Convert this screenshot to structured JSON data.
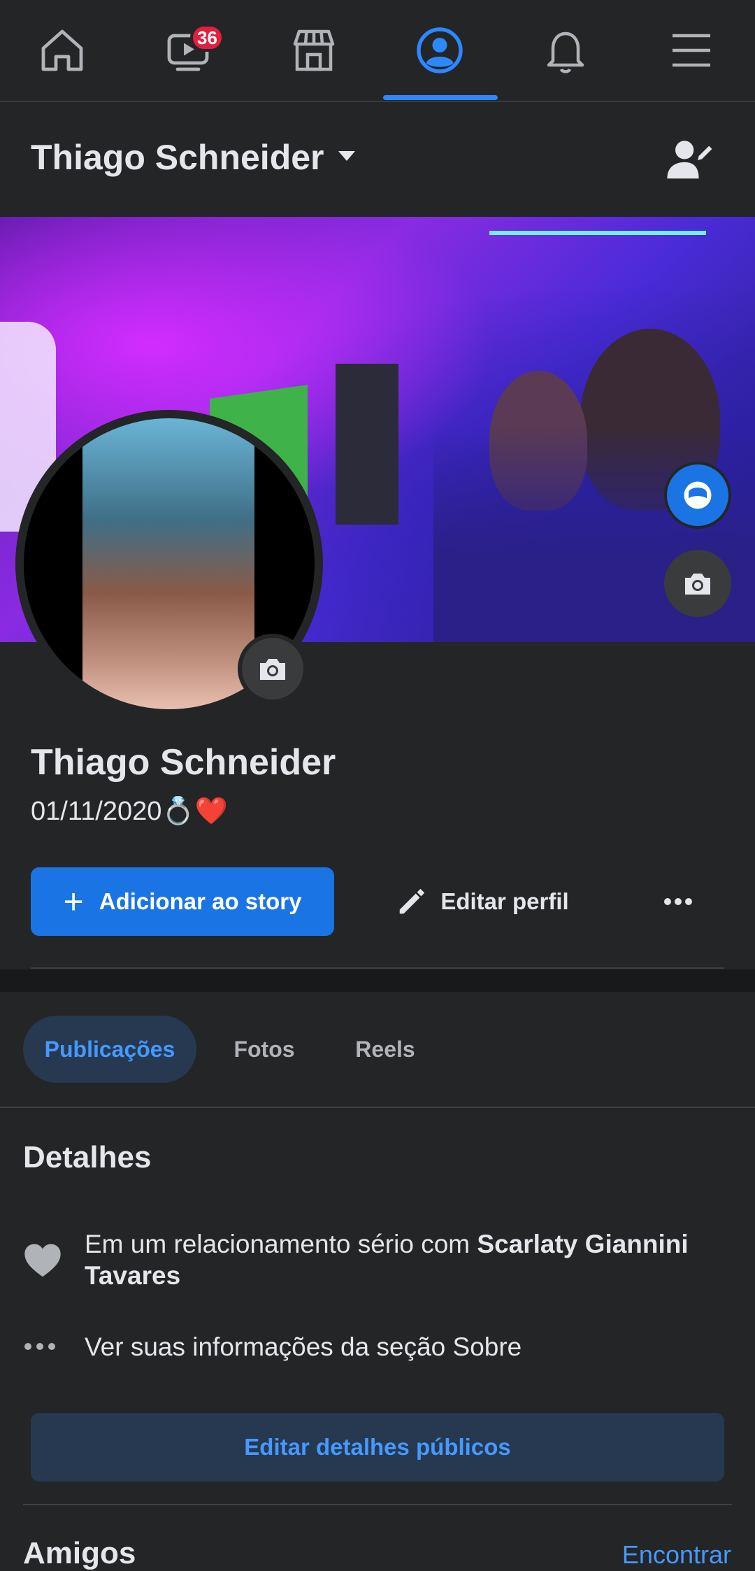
{
  "nav": {
    "items": [
      {
        "name": "home"
      },
      {
        "name": "watch",
        "badge": "36"
      },
      {
        "name": "marketplace"
      },
      {
        "name": "profile",
        "active": true
      },
      {
        "name": "notifications"
      },
      {
        "name": "menu"
      }
    ]
  },
  "header": {
    "name": "Thiago Schneider"
  },
  "profile": {
    "name": "Thiago Schneider",
    "bio": "01/11/2020💍❤️"
  },
  "actions": {
    "add_story": "Adicionar ao story",
    "edit_profile": "Editar perfil"
  },
  "tabs": [
    {
      "label": "Publicações",
      "active": true
    },
    {
      "label": "Fotos"
    },
    {
      "label": "Reels"
    }
  ],
  "details": {
    "title": "Detalhes",
    "relationship_prefix": "Em um relacionamento sério com ",
    "relationship_partner": "Scarlaty Giannini Tavares",
    "about_link": "Ver suas informações da seção Sobre",
    "edit_public": "Editar detalhes públicos"
  },
  "friends": {
    "title": "Amigos",
    "find": "Encontrar"
  },
  "colors": {
    "background": "#242526",
    "accent": "#1b74e4",
    "accent_text": "#4599ff",
    "badge": "#e41e3f"
  }
}
